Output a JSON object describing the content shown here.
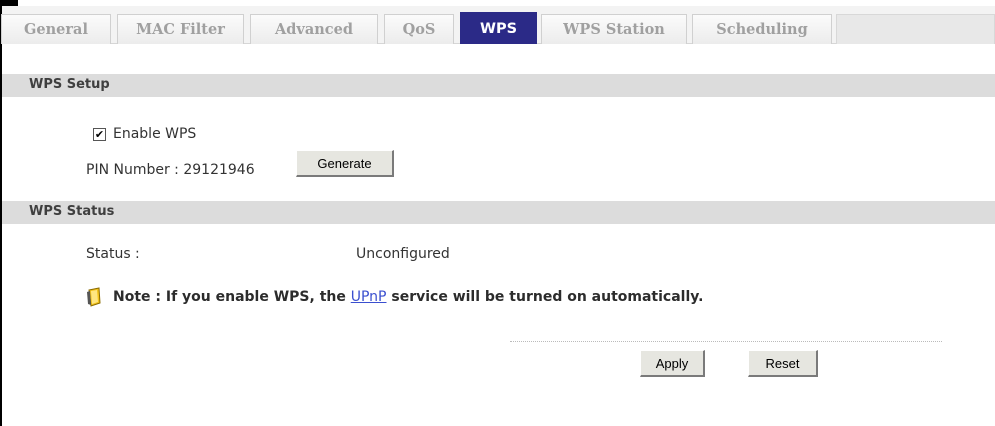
{
  "tabs": [
    {
      "label": "General"
    },
    {
      "label": "MAC Filter"
    },
    {
      "label": "Advanced"
    },
    {
      "label": "QoS"
    },
    {
      "label": "WPS"
    },
    {
      "label": "WPS Station"
    },
    {
      "label": "Scheduling"
    }
  ],
  "active_tab": "WPS",
  "wps_setup": {
    "title": "WPS Setup",
    "enable_label": "Enable WPS",
    "enable_checked": true,
    "pin_label": "PIN Number : 29121946",
    "generate_label": "Generate"
  },
  "wps_status": {
    "title": "WPS Status",
    "status_label": "Status :",
    "status_value": "Unconfigured"
  },
  "note": {
    "prefix": "Note : If you enable WPS, the ",
    "link": "UPnP",
    "suffix": " service will be turned on automatically."
  },
  "actions": {
    "apply_label": "Apply",
    "reset_label": "Reset"
  },
  "colors": {
    "active_tab_bg": "#2b2a87",
    "section_header_bg": "#dcdcdc",
    "link": "#3a4fcf"
  }
}
